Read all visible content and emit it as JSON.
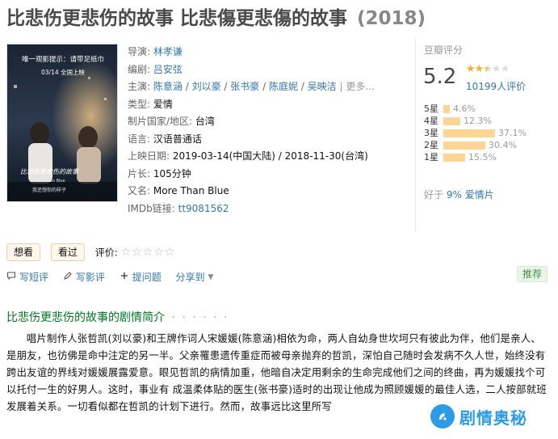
{
  "movie": {
    "title": "比悲伤更悲伤的故事 比悲傷更悲傷的故事",
    "year": "(2018)"
  },
  "poster": {
    "tagline": "唯一观影提示：请带足纸巾",
    "release": "03/14 全国上映",
    "handwritten_title": "比悲伤更悲伤的故事",
    "english": "More Than Blue",
    "bottom_line": "我还想你的样子"
  },
  "info": {
    "director_label": "导演:",
    "director": "林孝谦",
    "writer_label": "编剧:",
    "writer": "吕安弦",
    "cast_label": "主演:",
    "cast": [
      "陈意涵",
      "刘以豪",
      "张书豪",
      "陈庭妮",
      "吴映洁"
    ],
    "cast_sep": " / ",
    "cast_more": "| 更多...",
    "genre_label": "类型:",
    "genre": "爱情",
    "country_label": "制片国家/地区:",
    "country": "台湾",
    "language_label": "语言:",
    "language": "汉语普通话",
    "release_label": "上映日期:",
    "release": "2019-03-14(中国大陆) / 2018-11-30(台湾)",
    "runtime_label": "片长:",
    "runtime": "105分钟",
    "aka_label": "又名:",
    "aka": "More Than Blue",
    "imdb_label": "IMDb链接:",
    "imdb": "tt9081562"
  },
  "rating": {
    "title": "豆瓣评分",
    "score": "5.2",
    "stars_value": 2.5,
    "count": "10199人评价",
    "star_color": "#ffac2d",
    "bar_color": "#ffd596",
    "bars": [
      {
        "label": "5星",
        "pct": "4.6%",
        "value": 4.6
      },
      {
        "label": "4星",
        "pct": "12.3%",
        "value": 12.3
      },
      {
        "label": "3星",
        "pct": "37.1%",
        "value": 37.1
      },
      {
        "label": "2星",
        "pct": "30.4%",
        "value": 30.4
      },
      {
        "label": "1星",
        "pct": "15.5%",
        "value": 15.5
      }
    ],
    "better_than_prefix": "好于",
    "better_than_pct": "9%",
    "better_than_genre": "爱情片"
  },
  "actions": {
    "want": "想看",
    "watched": "看过",
    "rate_label": "评价:",
    "rate_stars": "☆☆☆☆☆"
  },
  "toolbar": {
    "short_review": "写短评",
    "review": "写影评",
    "ask": "提问题",
    "share": "分享到"
  },
  "recommend": "推荐",
  "synopsis": {
    "title": "比悲伤更悲伤的故事的剧情简介",
    "dots": "· · · · · ·",
    "text": "唱片制作人张哲凯(刘以豪)和王牌作词人宋媛媛(陈意涵)相依为命，两人自幼身世坎坷只有彼此为伴，他们是亲人、是朋友，也彷佛是命中注定的另一半。父亲罹患遗传重症而被母亲抛弃的哲凯，深怕自己随时会发病不久人世，始终没有跨出友谊的界线对媛媛展露爱意。眼见哲凯的病情加重，他暗自决定用剩余的生命完成他们之间的终曲，再为媛媛找个可以托付一生的好男人。这时，事业有 成温柔体贴的医生(张书豪)适时的出现让他成为照顾媛媛的最佳人选，二人按部就班发展着关系。一切看似都在哲凯的计划下进行。然而，故事远比这里所写"
  },
  "watermark": {
    "text": "剧情奥秘",
    "color": "#2e9be6"
  },
  "colors": {
    "link": "#3377aa",
    "section_green": "#007722",
    "label_gray": "#666666"
  }
}
